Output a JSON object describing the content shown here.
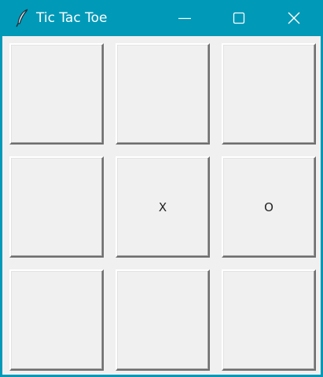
{
  "window": {
    "title": "Tic Tac Toe",
    "app_icon": "feather-icon",
    "controls": [
      "minimize-icon",
      "maximize-icon",
      "close-icon"
    ],
    "accent_color": "#0099b8"
  },
  "board": {
    "rows": [
      [
        "",
        "",
        ""
      ],
      [
        "",
        "X",
        "O"
      ],
      [
        "",
        "",
        ""
      ]
    ]
  }
}
